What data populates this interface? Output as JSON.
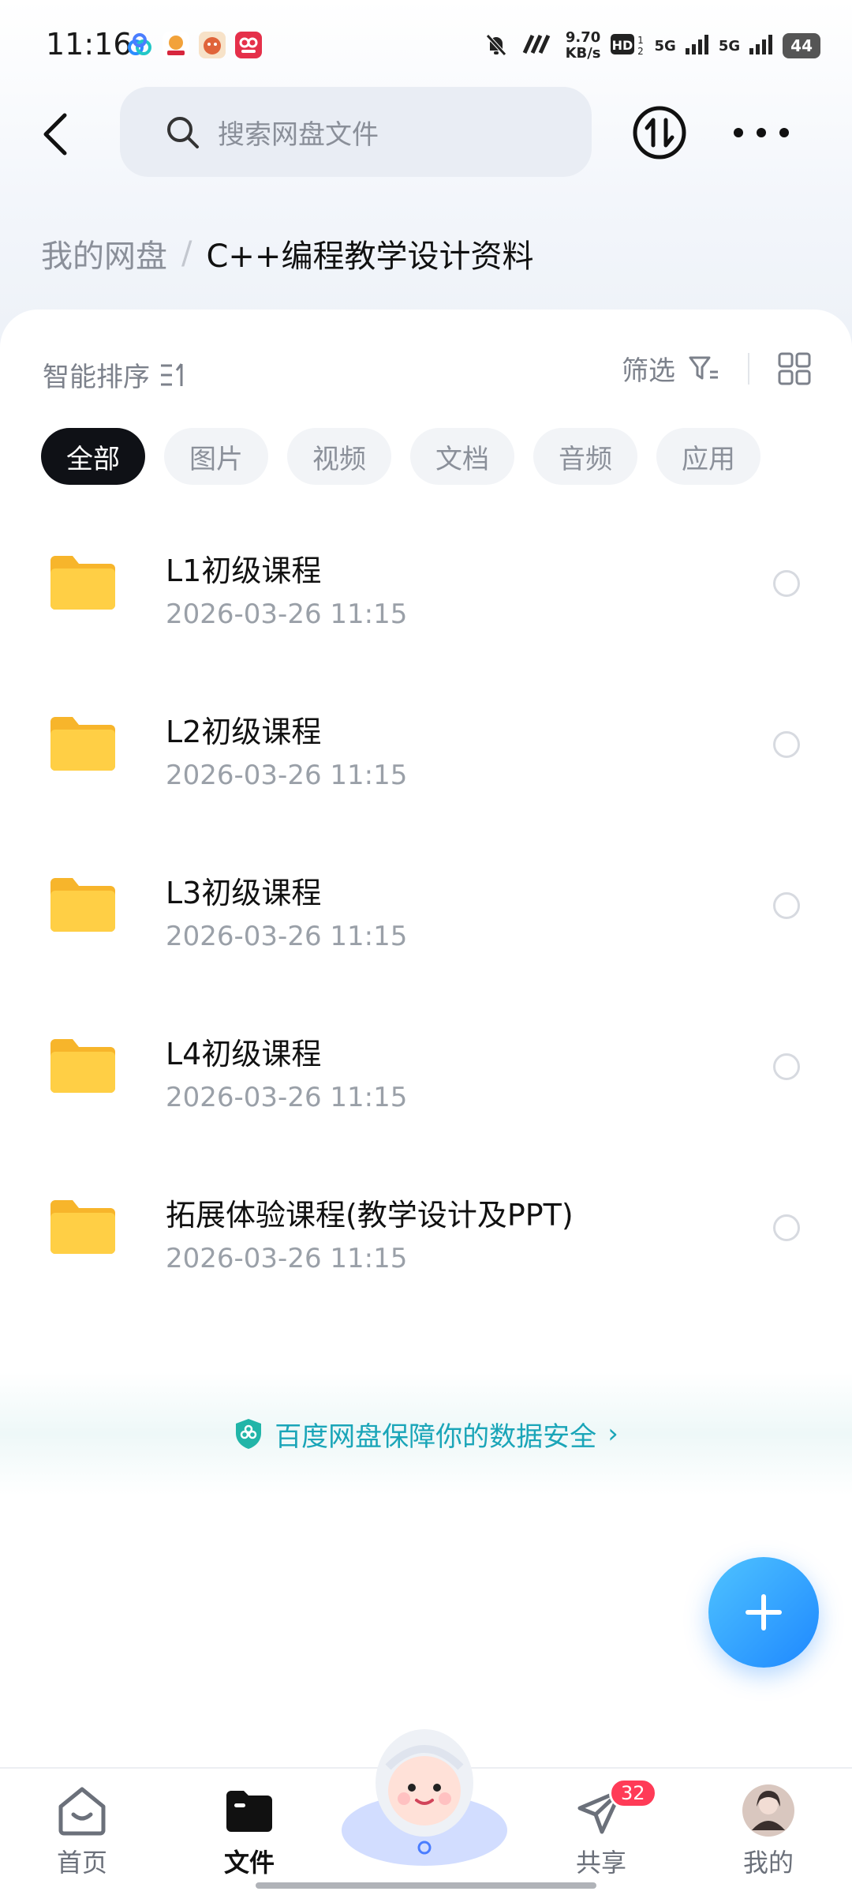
{
  "status_bar": {
    "time": "11:16",
    "speed": "9.70",
    "speed_unit": "KB/s",
    "net1": "5G",
    "net2": "5G",
    "battery": "44"
  },
  "header": {
    "search_placeholder": "搜索网盘文件"
  },
  "breadcrumb": {
    "root": "我的网盘",
    "separator": "/",
    "current": "C++编程教学设计资料"
  },
  "toolbar": {
    "sort_label": "智能排序",
    "filter_label": "筛选"
  },
  "tabs": [
    {
      "label": "全部",
      "active": true
    },
    {
      "label": "图片",
      "active": false
    },
    {
      "label": "视频",
      "active": false
    },
    {
      "label": "文档",
      "active": false
    },
    {
      "label": "音频",
      "active": false
    },
    {
      "label": "应用",
      "active": false
    }
  ],
  "files": [
    {
      "name": "L1初级课程",
      "date": "2026-03-26  11:15"
    },
    {
      "name": "L2初级课程",
      "date": "2026-03-26  11:15"
    },
    {
      "name": "L3初级课程",
      "date": "2026-03-26  11:15"
    },
    {
      "name": "L4初级课程",
      "date": "2026-03-26  11:15"
    },
    {
      "name": "拓展体验课程(教学设计及PPT)",
      "date": "2026-03-26  11:15"
    }
  ],
  "safety": {
    "text": "百度网盘保障你的数据安全",
    "chevron": "›"
  },
  "bottom_nav": {
    "home": "首页",
    "files": "文件",
    "share": "共享",
    "share_badge": "32",
    "mine": "我的"
  },
  "colors": {
    "accent": "#1e88ff",
    "safety": "#1aa5b8",
    "folder": "#ffc93c",
    "badge": "#ff3b57"
  }
}
